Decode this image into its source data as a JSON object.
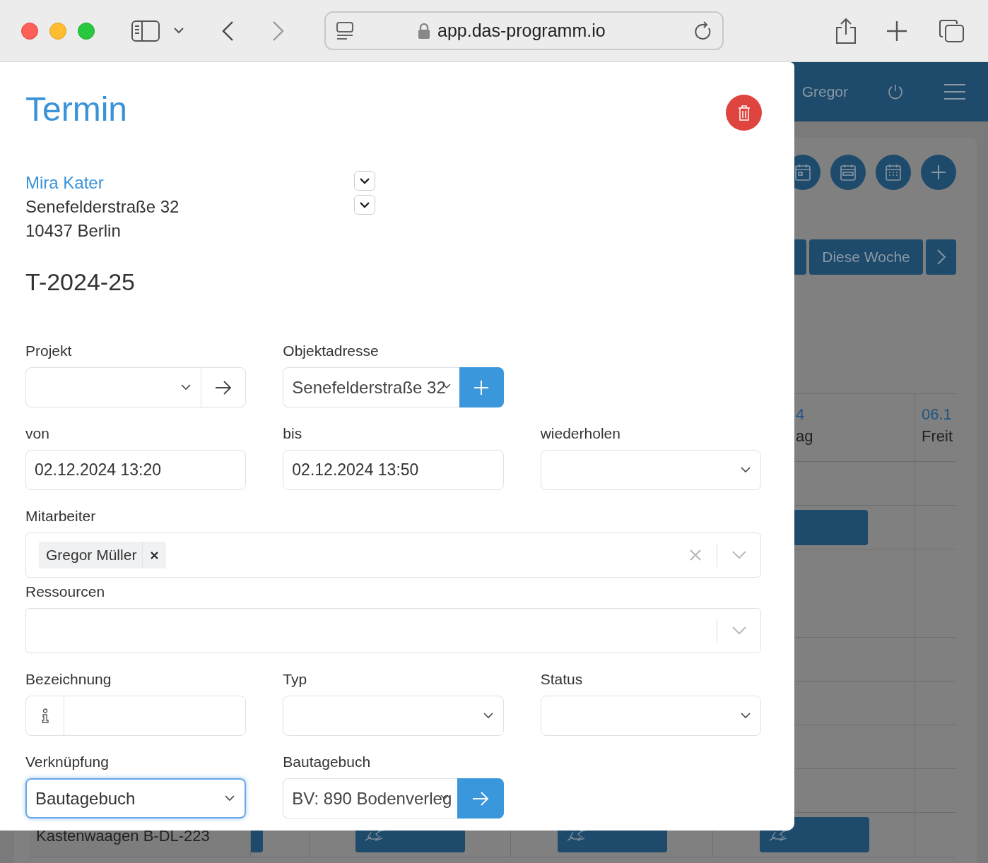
{
  "browser": {
    "url": "app.das-programm.io",
    "back": {
      "disabled": false
    },
    "forward": {
      "disabled": true
    }
  },
  "app_header": {
    "user": "Gregor"
  },
  "week_nav": {
    "label": "Diese Woche"
  },
  "calendar": {
    "day_columns": [
      {
        "date": "4",
        "weekday": "ag"
      },
      {
        "date": "06.1",
        "weekday": "Freit"
      }
    ],
    "resource_rows": [
      {
        "name": "Kastenwaagen B-DL-223"
      }
    ]
  },
  "dialog": {
    "title": "Termin",
    "contact": {
      "name": "Mira Kater",
      "street": "Senefelderstraße 32",
      "city": "10437 Berlin"
    },
    "number": "T-2024-25",
    "rows": [
      {
        "fields": [
          {
            "kind": "select_link",
            "label": "Projekt"
          },
          {
            "kind": "input_add",
            "label": "Objektadresse",
            "value": "Senefelderstraße 32"
          }
        ]
      },
      {
        "fields": [
          {
            "kind": "input",
            "label": "von",
            "value": "02.12.2024 13:20"
          },
          {
            "kind": "input",
            "label": "bis",
            "value": "02.12.2024 13:50"
          },
          {
            "kind": "select",
            "label": "wiederholen"
          }
        ]
      },
      {
        "fields": [
          {
            "kind": "multiselect",
            "label": "Mitarbeiter",
            "tags": [
              {
                "label": "Gregor Müller"
              }
            ],
            "clearable": true
          }
        ]
      },
      {
        "fields": [
          {
            "kind": "multiselect",
            "label": "Ressourcen",
            "clearable": false
          }
        ]
      },
      {
        "fields": [
          {
            "kind": "input_icon",
            "label": "Bezeichnung"
          },
          {
            "kind": "select",
            "label": "Typ"
          },
          {
            "kind": "select",
            "label": "Status"
          }
        ]
      },
      {
        "fields": [
          {
            "kind": "select",
            "label": "Verknüpfung",
            "value": "Bautagebuch",
            "focused": true
          },
          {
            "kind": "input_link",
            "label": "Bautagebuch",
            "value": "BV: 890 Bodenverleg"
          }
        ]
      }
    ]
  }
}
